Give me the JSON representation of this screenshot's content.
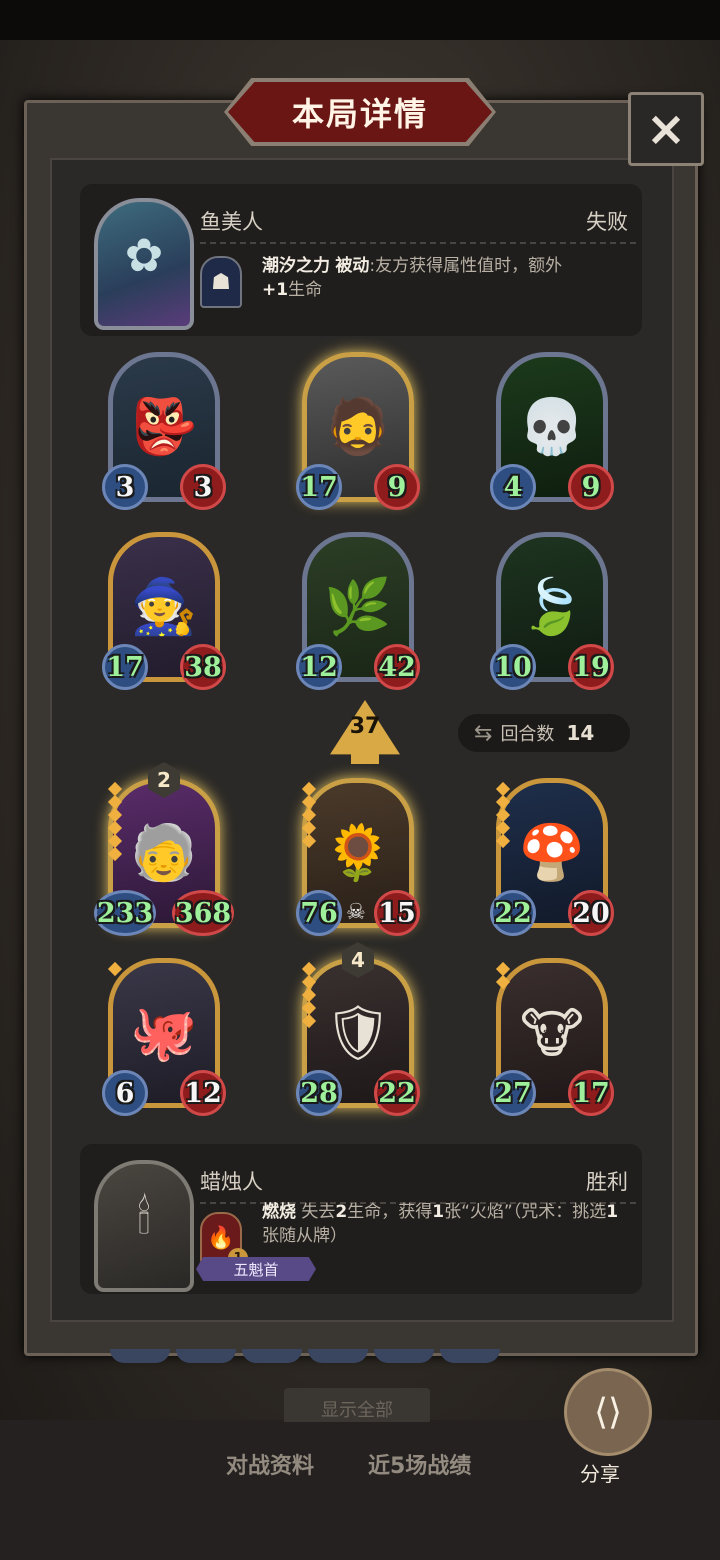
{
  "title": "本局详情",
  "close_icon": "×",
  "opponent": {
    "name": "鱼美人",
    "result": "失败",
    "skill_name": "潮汐之力",
    "skill_tag": "被动",
    "skill_desc": ":友方获得属性值时，额外",
    "skill_bonus": "+1",
    "skill_desc2": "生命",
    "portrait_icon": "mermaid-portrait",
    "skill_icon": "tide-skill-icon"
  },
  "opponent_minions": [
    {
      "atk": "3",
      "hp": "3",
      "art": "goblin-shaman"
    },
    {
      "atk": "17",
      "hp": "9",
      "art": "warrior-dwarf"
    },
    {
      "atk": "4",
      "hp": "9",
      "art": "skeleton-sorcerer"
    },
    {
      "atk": "17",
      "hp": "38",
      "art": "hooded-brute"
    },
    {
      "atk": "12",
      "hp": "42",
      "art": "leaf-girl"
    },
    {
      "atk": "10",
      "hp": "19",
      "art": "forest-dryad"
    }
  ],
  "center_badge": {
    "value": "37",
    "icon": "tier-arrow-icon"
  },
  "rounds": {
    "label": "回合数",
    "value": "14",
    "icon": "swap-icon"
  },
  "player_minions": [
    {
      "atk": "233",
      "hp": "368",
      "level": "2",
      "art": "mad-scientist"
    },
    {
      "atk": "76",
      "hp": "15",
      "art": "scarecrow"
    },
    {
      "atk": "22",
      "hp": "20",
      "art": "mushroom-elf"
    },
    {
      "atk": "6",
      "hp": "12",
      "art": "octopus-pirate"
    },
    {
      "atk": "28",
      "hp": "22",
      "level": "4",
      "art": "dark-knight"
    },
    {
      "atk": "27",
      "hp": "17",
      "art": "cow-reaper"
    }
  ],
  "player": {
    "name": "蜡烛人",
    "result": "胜利",
    "skill_name": "燃烧",
    "skill_desc": "失去",
    "skill_num1": "2",
    "skill_desc2": "生命，获得",
    "skill_num2": "1",
    "skill_desc3": "张“火焰”（咒术：挑选",
    "skill_num3": "1",
    "skill_desc4": "张随从牌）",
    "skill_cost": "1",
    "badge": "五魁首",
    "portrait_icon": "candle-man-portrait",
    "skill_icon": "flame-skill-icon"
  },
  "footer": {
    "show_all": "显示全部",
    "tab1": "对战资料",
    "tab2": "近5场战绩",
    "share": "分享",
    "share_icon": "share-icon"
  },
  "colors": {
    "accent": "#c9a045",
    "banner": "#6a1614",
    "atk": "#2e4e82",
    "hp": "#8e1c1c",
    "buffed": "#9ef09a"
  }
}
